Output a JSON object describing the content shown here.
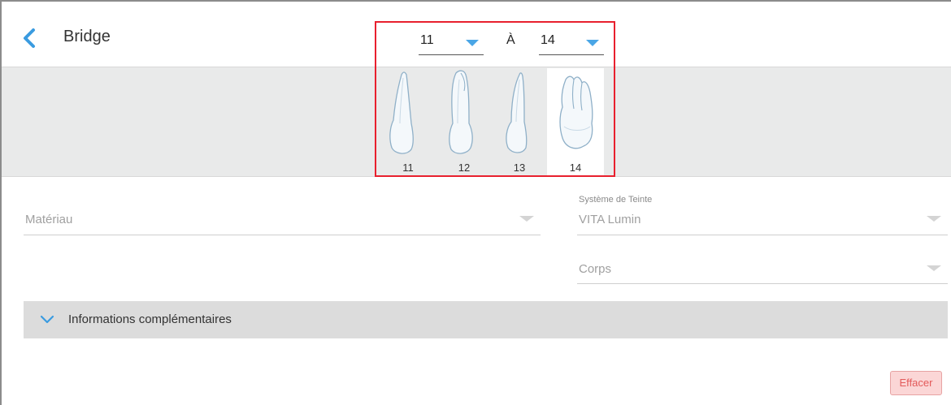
{
  "header": {
    "title": "Bridge"
  },
  "range": {
    "from": "11",
    "separator": "À",
    "to": "14"
  },
  "teeth": [
    {
      "number": "11",
      "selected": false
    },
    {
      "number": "12",
      "selected": false
    },
    {
      "number": "13",
      "selected": false
    },
    {
      "number": "14",
      "selected": true
    }
  ],
  "form": {
    "material_label": "Matériau",
    "shade_system_caption": "Système de Teinte",
    "shade_system_value": "VITA Lumin",
    "body_label": "Corps"
  },
  "accordion": {
    "label": "Informations complémentaires"
  },
  "actions": {
    "clear_label": "Effacer"
  },
  "colors": {
    "accent": "#4aa6e6",
    "highlight_border": "#e8202e",
    "clear_bg": "#fbd6d6",
    "clear_text": "#e35a5a"
  }
}
